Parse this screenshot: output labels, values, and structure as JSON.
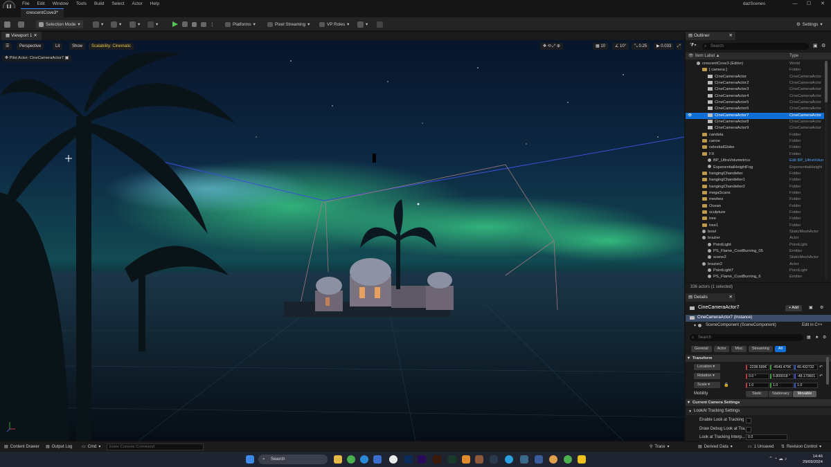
{
  "menubar": {
    "menus": [
      "File",
      "Edit",
      "Window",
      "Tools",
      "Build",
      "Select",
      "Actor",
      "Help"
    ],
    "project": "dazScenes",
    "logo": "U"
  },
  "tabs": {
    "level_tab": "crescentCove3*"
  },
  "toolbar": {
    "selection_mode": "Selection Mode",
    "platforms": "Platforms",
    "pixel_streaming": "Pixel Streaming",
    "vp_roles": "VP Roles",
    "settings": "Settings"
  },
  "viewport": {
    "tab": "Viewport 1",
    "perspective": "Perspective",
    "lit": "Lit",
    "show": "Show",
    "scalability": "Scalability: Cinematic",
    "pilot": "Pilot Actor: CineCameraActor7",
    "grid_snap": "10",
    "rot_snap": "10°",
    "scale_snap": "0.25",
    "cam_speed": "0.033"
  },
  "outliner": {
    "tab": "Outliner",
    "search_placeholder": "Search",
    "col_label": "Item Label ▲",
    "col_type": "Type",
    "rows": [
      {
        "label": "crescentCove3 (Editor)",
        "type": "World",
        "indent": 1,
        "icon": "world-icon"
      },
      {
        "label": "[ camera ]",
        "type": "Folder",
        "indent": 2,
        "icon": "folder-icon"
      },
      {
        "label": "CineCameraActor",
        "type": "CineCameraActor",
        "indent": 3,
        "icon": "camera-icon"
      },
      {
        "label": "CineCameraActor2",
        "type": "CineCameraActor",
        "indent": 3,
        "icon": "camera-icon"
      },
      {
        "label": "CineCameraActor3",
        "type": "CineCameraActor",
        "indent": 3,
        "icon": "camera-icon"
      },
      {
        "label": "CineCameraActor4",
        "type": "CineCameraActor",
        "indent": 3,
        "icon": "camera-icon"
      },
      {
        "label": "CineCameraActor5",
        "type": "CineCameraActor",
        "indent": 3,
        "icon": "camera-icon"
      },
      {
        "label": "CineCameraActor6",
        "type": "CineCameraActor",
        "indent": 3,
        "icon": "camera-icon"
      },
      {
        "label": "CineCameraActor7",
        "type": "CineCameraActor",
        "indent": 3,
        "icon": "camera-icon",
        "selected": true
      },
      {
        "label": "CineCameraActor8",
        "type": "CineCameraActor",
        "indent": 3,
        "icon": "camera-icon"
      },
      {
        "label": "CineCameraActor9",
        "type": "CineCameraActor",
        "indent": 3,
        "icon": "camera-icon"
      },
      {
        "label": "candela",
        "type": "Folder",
        "indent": 2,
        "icon": "folder-icon"
      },
      {
        "label": "canoe",
        "type": "Folder",
        "indent": 2,
        "icon": "folder-icon"
      },
      {
        "label": "celestialGlobe",
        "type": "Folder",
        "indent": 2,
        "icon": "folder-icon"
      },
      {
        "label": "FX",
        "type": "Folder",
        "indent": 2,
        "icon": "folder-icon"
      },
      {
        "label": "BP_UltraVolumetrics",
        "type": "Edit BP_UltraVolun",
        "indent": 3,
        "icon": "actor-icon",
        "link": true
      },
      {
        "label": "ExponentialHeightFog",
        "type": "ExponentialHeight",
        "indent": 3,
        "icon": "actor-icon"
      },
      {
        "label": "hangingChandelier",
        "type": "Folder",
        "indent": 2,
        "icon": "folder-icon"
      },
      {
        "label": "hangingChandelier1",
        "type": "Folder",
        "indent": 2,
        "icon": "folder-icon"
      },
      {
        "label": "hangingChandelier2",
        "type": "Folder",
        "indent": 2,
        "icon": "folder-icon"
      },
      {
        "label": "megaScans",
        "type": "Folder",
        "indent": 2,
        "icon": "folder-icon"
      },
      {
        "label": "meshes",
        "type": "Folder",
        "indent": 2,
        "icon": "folder-icon"
      },
      {
        "label": "Ocean",
        "type": "Folder",
        "indent": 2,
        "icon": "folder-icon"
      },
      {
        "label": "sculpture",
        "type": "Folder",
        "indent": 2,
        "icon": "folder-icon"
      },
      {
        "label": "tree",
        "type": "Folder",
        "indent": 2,
        "icon": "folder-icon"
      },
      {
        "label": "tree1",
        "type": "Folder",
        "indent": 2,
        "icon": "folder-icon"
      },
      {
        "label": "bowl",
        "type": "StaticMeshActor",
        "indent": 2,
        "icon": "actor-icon"
      },
      {
        "label": "brazier",
        "type": "Actor",
        "indent": 2,
        "icon": "actor-icon"
      },
      {
        "label": "PointLight",
        "type": "PointLight",
        "indent": 3,
        "icon": "light-icon"
      },
      {
        "label": "PS_Flame_CostBurning_05",
        "type": "Emitter",
        "indent": 3,
        "icon": "actor-icon"
      },
      {
        "label": "scene2",
        "type": "StaticMeshActor",
        "indent": 3,
        "icon": "actor-icon"
      },
      {
        "label": "brazier2",
        "type": "Actor",
        "indent": 2,
        "icon": "actor-icon"
      },
      {
        "label": "PointLight7",
        "type": "PointLight",
        "indent": 3,
        "icon": "light-icon"
      },
      {
        "label": "PS_Flame_CostBurning_6",
        "type": "Emitter",
        "indent": 3,
        "icon": "actor-icon"
      }
    ],
    "footer": "336 actors (1 selected)"
  },
  "details": {
    "tab": "Details",
    "actor_name": "CineCameraActor7",
    "add_label": "+ Add",
    "instance_label": "CineCameraActor7 (Instance)",
    "component_label": "SceneComponent (SceneComponent)",
    "edit_cpp": "Edit in C++",
    "search_placeholder": "Search",
    "filters": [
      "General",
      "Actor",
      "Misc",
      "Streaming",
      "All"
    ],
    "transform_section": "Transform",
    "location_label": "Location",
    "location": [
      "-2238.599€",
      "-4549.479€",
      "40.432732"
    ],
    "rotation_label": "Rotation",
    "rotation": [
      "0.0 °",
      "5.800018 °",
      "-48.179601"
    ],
    "scale_label": "Scale",
    "scale": [
      "1.0",
      "1.0",
      "1.0"
    ],
    "mobility_label": "Mobility",
    "mobility_options": [
      "Static",
      "Stationary",
      "Movable"
    ],
    "camera_section": "Current Camera Settings",
    "lookat_section": "LookAt Tracking Settings",
    "lookat_rows": [
      "Enable Look at Tracking",
      "Draw Debug Look at Tra...",
      "Look at Tracking Interp..."
    ],
    "lookat_value": "0.0"
  },
  "statusbar": {
    "content_drawer": "Content Drawer",
    "output_log": "Output Log",
    "cmd": "Cmd",
    "console_placeholder": "Enter Console Command",
    "trace": "Trace",
    "derived_data": "Derived Data",
    "unsaved": "1 Unsaved",
    "revision_control": "Revision Control"
  },
  "taskbar": {
    "search": "Search",
    "time": "14:46",
    "date": "29/09/2024"
  }
}
